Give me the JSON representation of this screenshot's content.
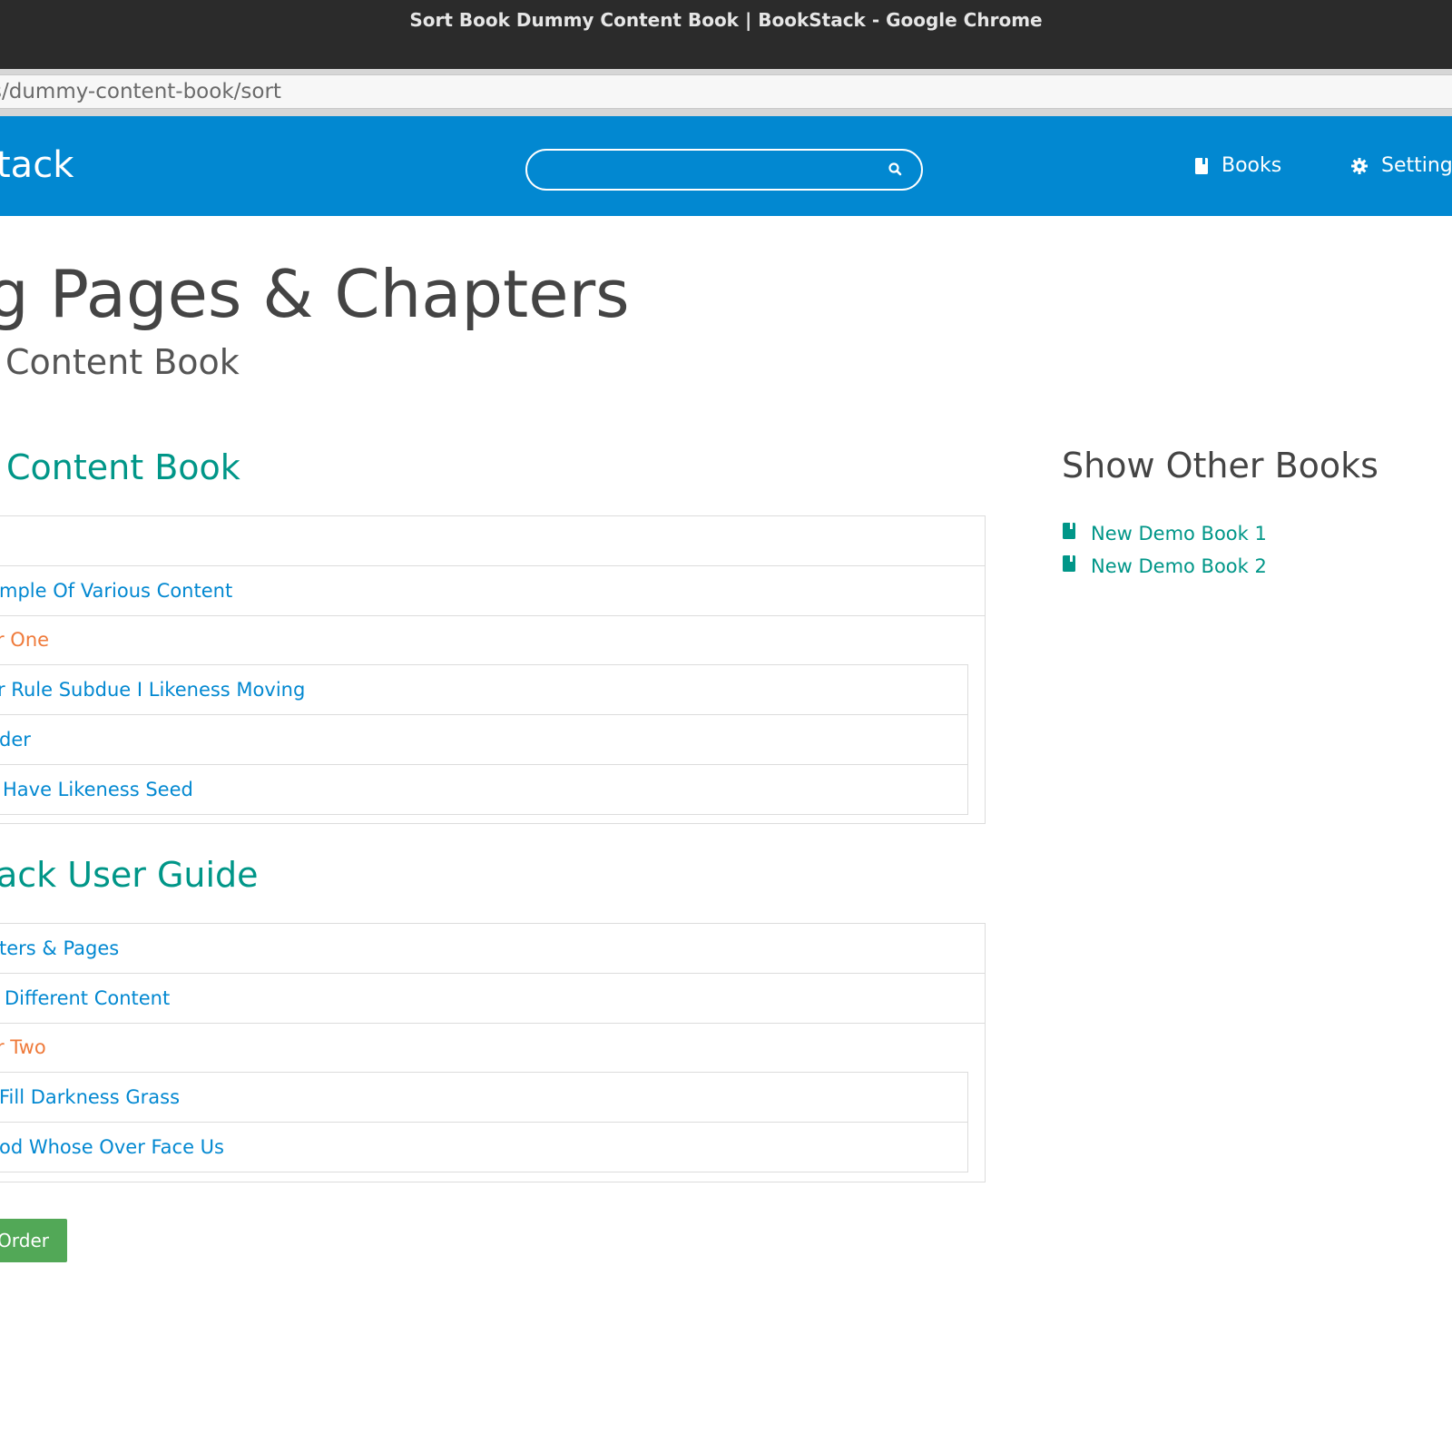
{
  "window": {
    "title": "Sort Book Dummy Content Book | BookStack - Google Chrome",
    "url": "s/dummy-content-book/sort"
  },
  "header": {
    "logo": "tack",
    "search_placeholder": "",
    "nav": [
      {
        "label": "Books",
        "icon": "book-icon"
      },
      {
        "label": "Settings",
        "icon": "gear-icon"
      }
    ]
  },
  "page": {
    "title": "g Pages & Chapters",
    "subtitle": "Content Book"
  },
  "books": [
    {
      "title": "Content Book",
      "items": [
        {
          "label": "",
          "type": "page"
        },
        {
          "label": "mple Of Various Content",
          "type": "page"
        },
        {
          "label": "r One",
          "type": "chapter"
        },
        {
          "label": "r Rule Subdue I Likeness Moving",
          "type": "chapter-page"
        },
        {
          "label": "der",
          "type": "chapter-page"
        },
        {
          "label": "Have Likeness Seed",
          "type": "chapter-page"
        }
      ]
    },
    {
      "title": "ack User Guide",
      "items": [
        {
          "label": "ters & Pages",
          "type": "page"
        },
        {
          "label": "Different Content",
          "type": "page"
        },
        {
          "label": "r Two",
          "type": "chapter"
        },
        {
          "label": "Fill Darkness Grass",
          "type": "chapter-page"
        },
        {
          "label": "od Whose Over Face Us",
          "type": "chapter-page"
        }
      ]
    }
  ],
  "sidebar": {
    "heading": "Show Other Books",
    "books": [
      "New Demo Book 1",
      "New Demo Book 2"
    ]
  },
  "save_button": "Order",
  "colors": {
    "header_bg": "#0288d1",
    "book_color": "#009688",
    "page_color": "#0288d1",
    "chapter_color": "#ef7a3a",
    "save_bg": "#52a857"
  }
}
